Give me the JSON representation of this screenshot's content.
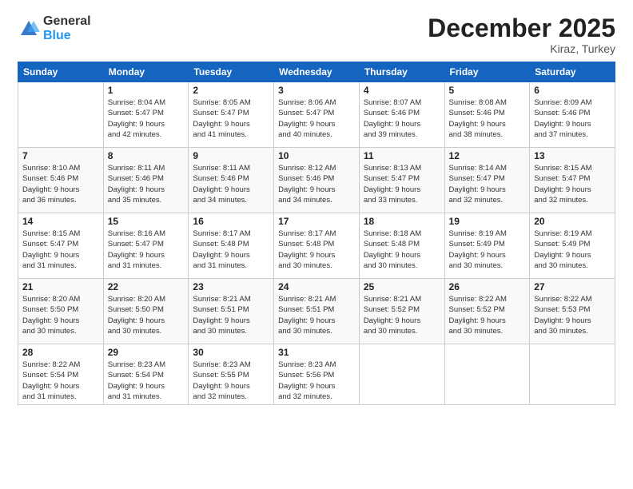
{
  "logo": {
    "general": "General",
    "blue": "Blue"
  },
  "header": {
    "month": "December 2025",
    "location": "Kiraz, Turkey"
  },
  "weekdays": [
    "Sunday",
    "Monday",
    "Tuesday",
    "Wednesday",
    "Thursday",
    "Friday",
    "Saturday"
  ],
  "weeks": [
    [
      {
        "day": "",
        "sunrise": "",
        "sunset": "",
        "daylight": ""
      },
      {
        "day": "1",
        "sunrise": "Sunrise: 8:04 AM",
        "sunset": "Sunset: 5:47 PM",
        "daylight": "Daylight: 9 hours and 42 minutes."
      },
      {
        "day": "2",
        "sunrise": "Sunrise: 8:05 AM",
        "sunset": "Sunset: 5:47 PM",
        "daylight": "Daylight: 9 hours and 41 minutes."
      },
      {
        "day": "3",
        "sunrise": "Sunrise: 8:06 AM",
        "sunset": "Sunset: 5:47 PM",
        "daylight": "Daylight: 9 hours and 40 minutes."
      },
      {
        "day": "4",
        "sunrise": "Sunrise: 8:07 AM",
        "sunset": "Sunset: 5:46 PM",
        "daylight": "Daylight: 9 hours and 39 minutes."
      },
      {
        "day": "5",
        "sunrise": "Sunrise: 8:08 AM",
        "sunset": "Sunset: 5:46 PM",
        "daylight": "Daylight: 9 hours and 38 minutes."
      },
      {
        "day": "6",
        "sunrise": "Sunrise: 8:09 AM",
        "sunset": "Sunset: 5:46 PM",
        "daylight": "Daylight: 9 hours and 37 minutes."
      }
    ],
    [
      {
        "day": "7",
        "sunrise": "Sunrise: 8:10 AM",
        "sunset": "Sunset: 5:46 PM",
        "daylight": "Daylight: 9 hours and 36 minutes."
      },
      {
        "day": "8",
        "sunrise": "Sunrise: 8:11 AM",
        "sunset": "Sunset: 5:46 PM",
        "daylight": "Daylight: 9 hours and 35 minutes."
      },
      {
        "day": "9",
        "sunrise": "Sunrise: 8:11 AM",
        "sunset": "Sunset: 5:46 PM",
        "daylight": "Daylight: 9 hours and 34 minutes."
      },
      {
        "day": "10",
        "sunrise": "Sunrise: 8:12 AM",
        "sunset": "Sunset: 5:46 PM",
        "daylight": "Daylight: 9 hours and 34 minutes."
      },
      {
        "day": "11",
        "sunrise": "Sunrise: 8:13 AM",
        "sunset": "Sunset: 5:47 PM",
        "daylight": "Daylight: 9 hours and 33 minutes."
      },
      {
        "day": "12",
        "sunrise": "Sunrise: 8:14 AM",
        "sunset": "Sunset: 5:47 PM",
        "daylight": "Daylight: 9 hours and 32 minutes."
      },
      {
        "day": "13",
        "sunrise": "Sunrise: 8:15 AM",
        "sunset": "Sunset: 5:47 PM",
        "daylight": "Daylight: 9 hours and 32 minutes."
      }
    ],
    [
      {
        "day": "14",
        "sunrise": "Sunrise: 8:15 AM",
        "sunset": "Sunset: 5:47 PM",
        "daylight": "Daylight: 9 hours and 31 minutes."
      },
      {
        "day": "15",
        "sunrise": "Sunrise: 8:16 AM",
        "sunset": "Sunset: 5:47 PM",
        "daylight": "Daylight: 9 hours and 31 minutes."
      },
      {
        "day": "16",
        "sunrise": "Sunrise: 8:17 AM",
        "sunset": "Sunset: 5:48 PM",
        "daylight": "Daylight: 9 hours and 31 minutes."
      },
      {
        "day": "17",
        "sunrise": "Sunrise: 8:17 AM",
        "sunset": "Sunset: 5:48 PM",
        "daylight": "Daylight: 9 hours and 30 minutes."
      },
      {
        "day": "18",
        "sunrise": "Sunrise: 8:18 AM",
        "sunset": "Sunset: 5:48 PM",
        "daylight": "Daylight: 9 hours and 30 minutes."
      },
      {
        "day": "19",
        "sunrise": "Sunrise: 8:19 AM",
        "sunset": "Sunset: 5:49 PM",
        "daylight": "Daylight: 9 hours and 30 minutes."
      },
      {
        "day": "20",
        "sunrise": "Sunrise: 8:19 AM",
        "sunset": "Sunset: 5:49 PM",
        "daylight": "Daylight: 9 hours and 30 minutes."
      }
    ],
    [
      {
        "day": "21",
        "sunrise": "Sunrise: 8:20 AM",
        "sunset": "Sunset: 5:50 PM",
        "daylight": "Daylight: 9 hours and 30 minutes."
      },
      {
        "day": "22",
        "sunrise": "Sunrise: 8:20 AM",
        "sunset": "Sunset: 5:50 PM",
        "daylight": "Daylight: 9 hours and 30 minutes."
      },
      {
        "day": "23",
        "sunrise": "Sunrise: 8:21 AM",
        "sunset": "Sunset: 5:51 PM",
        "daylight": "Daylight: 9 hours and 30 minutes."
      },
      {
        "day": "24",
        "sunrise": "Sunrise: 8:21 AM",
        "sunset": "Sunset: 5:51 PM",
        "daylight": "Daylight: 9 hours and 30 minutes."
      },
      {
        "day": "25",
        "sunrise": "Sunrise: 8:21 AM",
        "sunset": "Sunset: 5:52 PM",
        "daylight": "Daylight: 9 hours and 30 minutes."
      },
      {
        "day": "26",
        "sunrise": "Sunrise: 8:22 AM",
        "sunset": "Sunset: 5:52 PM",
        "daylight": "Daylight: 9 hours and 30 minutes."
      },
      {
        "day": "27",
        "sunrise": "Sunrise: 8:22 AM",
        "sunset": "Sunset: 5:53 PM",
        "daylight": "Daylight: 9 hours and 30 minutes."
      }
    ],
    [
      {
        "day": "28",
        "sunrise": "Sunrise: 8:22 AM",
        "sunset": "Sunset: 5:54 PM",
        "daylight": "Daylight: 9 hours and 31 minutes."
      },
      {
        "day": "29",
        "sunrise": "Sunrise: 8:23 AM",
        "sunset": "Sunset: 5:54 PM",
        "daylight": "Daylight: 9 hours and 31 minutes."
      },
      {
        "day": "30",
        "sunrise": "Sunrise: 8:23 AM",
        "sunset": "Sunset: 5:55 PM",
        "daylight": "Daylight: 9 hours and 32 minutes."
      },
      {
        "day": "31",
        "sunrise": "Sunrise: 8:23 AM",
        "sunset": "Sunset: 5:56 PM",
        "daylight": "Daylight: 9 hours and 32 minutes."
      },
      {
        "day": "",
        "sunrise": "",
        "sunset": "",
        "daylight": ""
      },
      {
        "day": "",
        "sunrise": "",
        "sunset": "",
        "daylight": ""
      },
      {
        "day": "",
        "sunrise": "",
        "sunset": "",
        "daylight": ""
      }
    ]
  ]
}
